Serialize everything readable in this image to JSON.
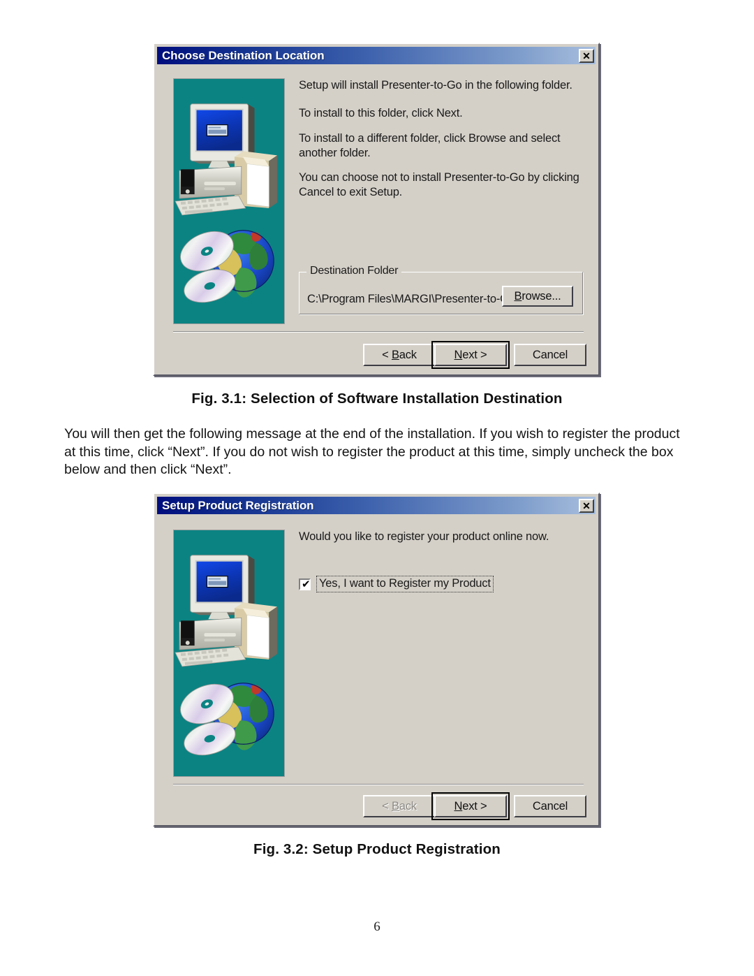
{
  "page": {
    "number": "6",
    "body_paragraph": "You will then get the following message at the end of the installation. If you wish to register the product at this time, click “Next”.  If you do not wish to register the product at this time, simply uncheck the box below and then click “Next”.",
    "caption_1": "Fig. 3.1: Selection of Software Installation Destination",
    "caption_2": "Fig. 3.2: Setup Product Registration"
  },
  "colors": {
    "dialog_face": "#d4d0c8",
    "titlebar_start": "#000e7d",
    "titlebar_end": "#a8bedd",
    "illustration_background": "#0b8383",
    "monitor_screen_blue": "#0b3fd0",
    "disabled_text": "#8d8a85"
  },
  "dialog_destination": {
    "title": "Choose Destination Location",
    "close_icon": "close-icon",
    "close_label": "✕",
    "illustration": "setup-computer-globe-cd-illustration",
    "paragraphs": [
      "Setup will install Presenter-to-Go in the following folder.",
      "To install to this folder, click Next.",
      "To install to a different folder, click Browse and select another folder.",
      "You can choose not to install Presenter-to-Go by clicking Cancel to exit Setup."
    ],
    "group": {
      "label": "Destination Folder",
      "path": "C:\\Program Files\\MARGI\\Presenter-to-Go",
      "browse_label": "Browse...",
      "browse_accel": "r"
    },
    "buttons": {
      "back": {
        "label": "< Back",
        "accel": "B",
        "disabled": false,
        "default": false
      },
      "next": {
        "label": "Next >",
        "accel": "N",
        "disabled": false,
        "default": true
      },
      "cancel": {
        "label": "Cancel",
        "accel": "",
        "disabled": false,
        "default": false
      }
    }
  },
  "dialog_registration": {
    "title": "Setup Product Registration",
    "close_icon": "close-icon",
    "close_label": "✕",
    "illustration": "setup-computer-globe-cd-illustration",
    "paragraphs": [
      "Would you like to register your product online now."
    ],
    "checkbox": {
      "label": "Yes, I want to Register my Product",
      "checked": true,
      "tick": "✔"
    },
    "buttons": {
      "back": {
        "label": "< Back",
        "accel": "B",
        "disabled": true,
        "default": false
      },
      "next": {
        "label": "Next >",
        "accel": "N",
        "disabled": false,
        "default": true
      },
      "cancel": {
        "label": "Cancel",
        "accel": "",
        "disabled": false,
        "default": false
      }
    }
  }
}
